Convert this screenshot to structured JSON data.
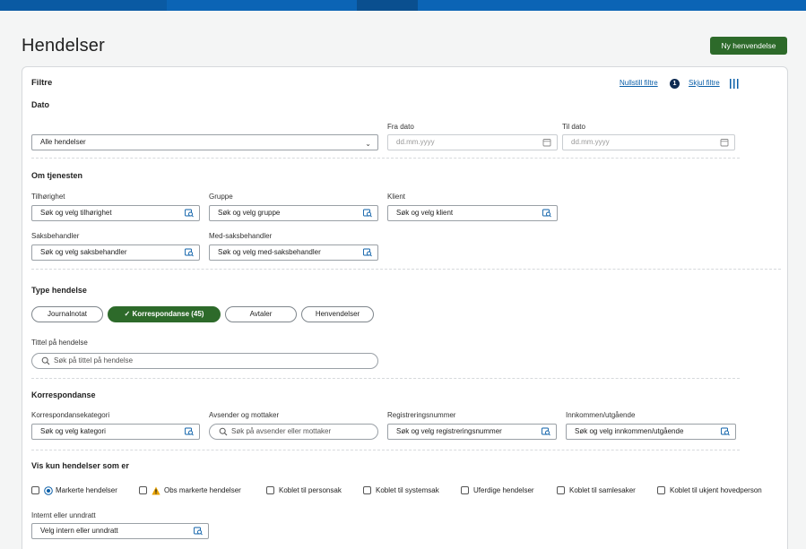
{
  "header": {
    "title": "Hendelser",
    "new_button": "Ny henvendelse"
  },
  "filters": {
    "title": "Filtre",
    "reset_link": "Nullstill filtre",
    "reset_count": "1",
    "hide_link": "Skjul filtre",
    "date": {
      "section": "Dato",
      "select_value": "Alle hendelser",
      "from_label": "Fra dato",
      "from_placeholder": "dd.mm.yyyy",
      "to_label": "Til dato",
      "to_placeholder": "dd.mm.yyyy"
    },
    "service": {
      "section": "Om tjenesten",
      "tilhorighet_label": "Tilhørighet",
      "tilhorighet_placeholder": "Søk og velg tilhørighet",
      "gruppe_label": "Gruppe",
      "gruppe_placeholder": "Søk og velg gruppe",
      "klient_label": "Klient",
      "klient_placeholder": "Søk og velg klient",
      "saksbehandler_label": "Saksbehandler",
      "saksbehandler_placeholder": "Søk og velg saksbehandler",
      "medsaks_label": "Med-saksbehandler",
      "medsaks_placeholder": "Søk og velg med-saksbehandler"
    },
    "type": {
      "section": "Type hendelse",
      "pills": [
        "Journalnotat",
        "Korrespondanse (45)",
        "Avtaler",
        "Henvendelser"
      ],
      "active_pill": "Korrespondanse (45)",
      "title_label": "Tittel på hendelse",
      "title_placeholder": "Søk på tittel på hendelse"
    },
    "correspondence": {
      "section": "Korrespondanse",
      "kategori_label": "Korrespondansekategori",
      "kategori_placeholder": "Søk og velg kategori",
      "avsender_label": "Avsender og mottaker",
      "avsender_placeholder": "Søk på avsender eller mottaker",
      "reg_label": "Registreringsnummer",
      "reg_placeholder": "Søk og velg registreringsnummer",
      "inn_label": "Innkommen/utgående",
      "inn_placeholder": "Søk og velg innkommen/utgående"
    },
    "visibility": {
      "section": "Vis kun hendelser som er",
      "options": [
        "Markerte hendelser",
        "Obs markerte hendelser",
        "Koblet til personsak",
        "Koblet til systemsak",
        "Uferdige hendelser",
        "Koblet til samlesaker",
        "Koblet til ukjent hovedperson"
      ],
      "internal_label": "Internt eller unndratt",
      "internal_placeholder": "Velg intern eller unndratt"
    }
  },
  "colors": {
    "primary_green": "#2d6a2a",
    "header_blue": "#0b64b5",
    "link_blue": "#0b5fa8",
    "badge_navy": "#0e2b52",
    "warning": "#e8a200"
  }
}
